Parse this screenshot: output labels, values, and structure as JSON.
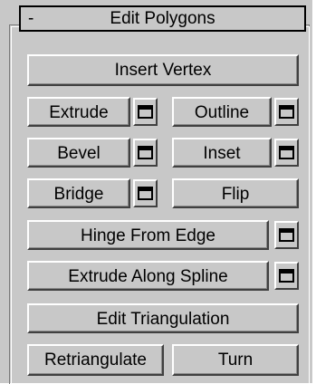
{
  "rollout": {
    "toggle": "-",
    "title": "Edit Polygons"
  },
  "buttons": {
    "insert_vertex": "Insert Vertex",
    "extrude": "Extrude",
    "outline": "Outline",
    "bevel": "Bevel",
    "inset": "Inset",
    "bridge": "Bridge",
    "flip": "Flip",
    "hinge_from_edge": "Hinge From Edge",
    "extrude_along_spline": "Extrude Along Spline",
    "edit_triangulation": "Edit Triangulation",
    "retriangulate": "Retriangulate",
    "turn": "Turn"
  },
  "icons": {
    "settings": "settings-window-icon"
  }
}
